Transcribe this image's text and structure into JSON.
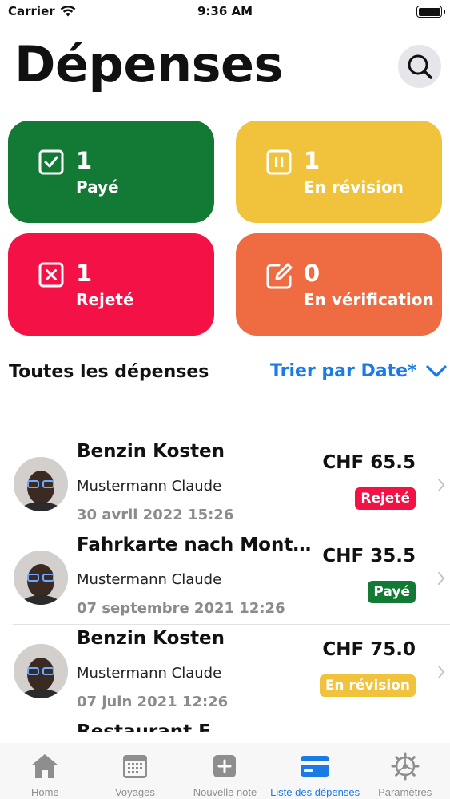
{
  "status_bar": {
    "carrier": "Carrier",
    "time": "9:36 AM"
  },
  "header": {
    "title": "Dépenses",
    "search_icon": "search-icon"
  },
  "summary": {
    "paid": {
      "count": "1",
      "label": "Payé",
      "color": "#137a35"
    },
    "review": {
      "count": "1",
      "label": "En révision",
      "color": "#f1c23c"
    },
    "rejected": {
      "count": "1",
      "label": "Rejeté",
      "color": "#f41146"
    },
    "verification": {
      "count": "0",
      "label": "En vérification",
      "color": "#ef6c42"
    }
  },
  "list_header": {
    "title": "Toutes les dépenses",
    "sort_label": "Trier par Date*"
  },
  "expenses": [
    {
      "title": "Benzin Kosten",
      "person": "Mustermann Claude",
      "date": "30 avril 2022 15:26",
      "amount": "CHF 65.5",
      "status": "Rejeté",
      "status_color": "#f41146"
    },
    {
      "title": "Fahrkarte nach Montabaur",
      "person": "Mustermann Claude",
      "date": "07 septembre 2021 12:26",
      "amount": "CHF 35.5",
      "status": "Payé",
      "status_color": "#137a35"
    },
    {
      "title": "Benzin Kosten",
      "person": "Mustermann Claude",
      "date": "07 juin 2021 12:26",
      "amount": "CHF 75.0",
      "status": "En révision",
      "status_color": "#f1c23c"
    },
    {
      "title": "Restaurant E",
      "person": "",
      "date": "",
      "amount": "",
      "status": "",
      "status_color": ""
    }
  ],
  "tabs": [
    {
      "label": "Home",
      "icon": "house-icon"
    },
    {
      "label": "Voyages",
      "icon": "calendar-icon"
    },
    {
      "label": "Nouvelle note",
      "icon": "plus-square-icon"
    },
    {
      "label": "Liste des dépenses",
      "icon": "credit-card-icon",
      "active": true
    },
    {
      "label": "Paramètres",
      "icon": "gear-icon"
    }
  ],
  "colors": {
    "accent": "#1a7be6"
  }
}
